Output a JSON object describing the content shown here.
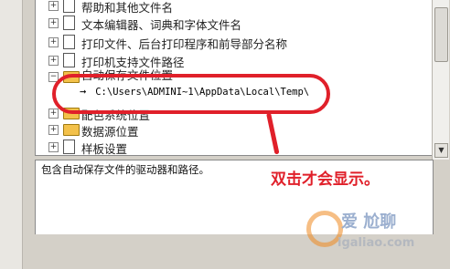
{
  "tree": {
    "items": [
      {
        "label": "帮助和其他文件名",
        "expander": "+",
        "icon": "document-icon"
      },
      {
        "label": "文本编辑器、词典和字体文件名",
        "expander": "+",
        "icon": "document-icon"
      },
      {
        "label": "打印文件、后台打印程序和前导部分名称",
        "expander": "+",
        "icon": "document-icon"
      },
      {
        "label": "打印机支持文件路径",
        "expander": "+",
        "icon": "document-icon"
      },
      {
        "label": "自动保存文件位置",
        "expander": "−",
        "icon": "folder-icon"
      },
      {
        "label": "配色系统位置",
        "expander": "+",
        "icon": "folder-icon"
      },
      {
        "label": "数据源位置",
        "expander": "+",
        "icon": "folder-icon"
      },
      {
        "label": "样板设置",
        "expander": "+",
        "icon": "document-icon"
      }
    ],
    "expanded_path": "C:\\Users\\ADMINI~1\\AppData\\Local\\Temp\\"
  },
  "description": "包含自动保存文件的驱动器和路径。",
  "annotation": "双击才会显示。",
  "colors": {
    "annotation_red": "#e0202a",
    "folder_yellow": "#f3c14a"
  }
}
